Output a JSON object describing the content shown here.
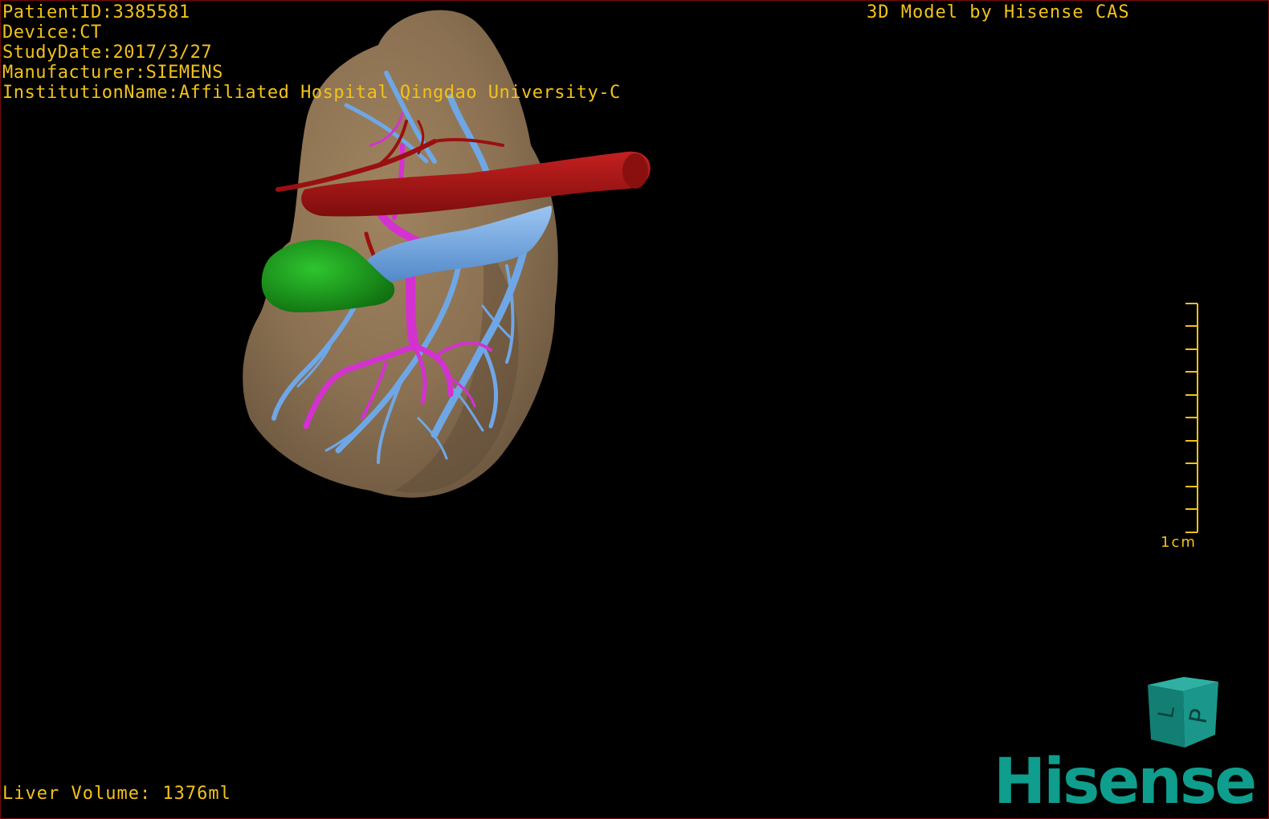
{
  "patient_info": {
    "patient_id": "PatientID:3385581",
    "device": "Device:CT",
    "study_date": "StudyDate:2017/3/27",
    "manufacturer": "Manufacturer:SIEMENS",
    "institution": "InstitutionName:Affiliated Hospital Qingdao University-C"
  },
  "credit": "3D Model by Hisense CAS",
  "liver_volume": "Liver Volume: 1376ml",
  "scale": {
    "label": "1cm"
  },
  "orientation_cube": {
    "face_front": "P",
    "face_side": "L"
  },
  "brand": "Hisense",
  "colors": {
    "overlay_text": "#f2c21a",
    "liver": "#8b7152",
    "artery": "#b01515",
    "portal_vein": "#d431d1",
    "hepatic_vein": "#6fa7e6",
    "gallbladder": "#1d9a1d",
    "brand": "#0f9d8d",
    "frame": "#7a0a0a"
  }
}
